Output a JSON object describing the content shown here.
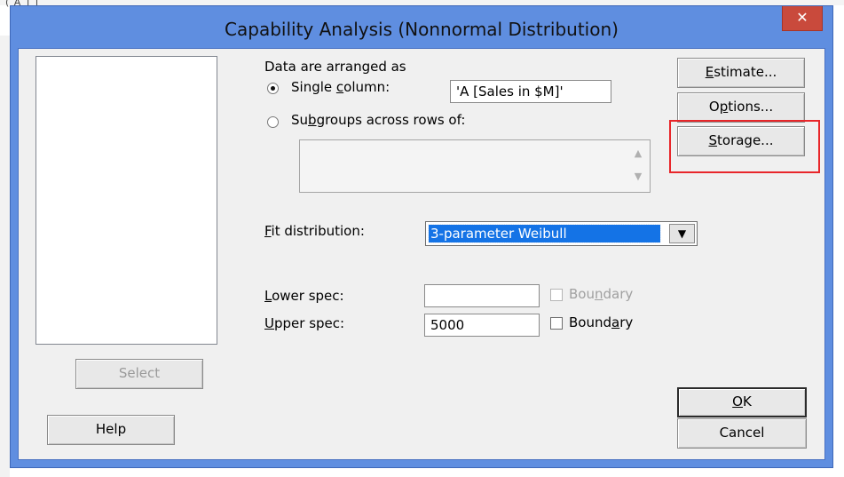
{
  "dialog": {
    "title": "Capability Analysis (Nonnormal Distribution)",
    "close_glyph": "✕"
  },
  "backdrop": {
    "fragment": "( A ] ]"
  },
  "variable_list": {
    "items": []
  },
  "data_arrangement": {
    "heading": "Data are arranged as",
    "single_column": {
      "label_pre": "Single ",
      "label_key": "c",
      "label_post": "olumn:",
      "value": "'A [Sales in $M]'",
      "selected": true
    },
    "subgroups": {
      "label_pre": "Su",
      "label_key": "b",
      "label_post": "groups across rows of:",
      "value": "",
      "selected": false
    }
  },
  "fit_distribution": {
    "label_key": "F",
    "label_post": "it distribution:",
    "selected": "3-parameter Weibull"
  },
  "lower_spec": {
    "label_key": "L",
    "label_post": "ower spec:",
    "value": "",
    "boundary_pre": "Bou",
    "boundary_key": "n",
    "boundary_post": "dary",
    "boundary_enabled": false
  },
  "upper_spec": {
    "label_key": "U",
    "label_post": "pper spec:",
    "value": "5000",
    "boundary_pre": "Bound",
    "boundary_key": "a",
    "boundary_post": "ry",
    "boundary_enabled": true
  },
  "buttons": {
    "estimate": {
      "key": "E",
      "post": "stimate..."
    },
    "options": {
      "pre": "O",
      "key": "p",
      "post": "tions..."
    },
    "storage": {
      "key": "S",
      "post": "torage..."
    },
    "select": "Select",
    "help": "Help",
    "ok": {
      "key": "O",
      "post": "K"
    },
    "cancel": "Cancel"
  },
  "colors": {
    "highlight": "#e8262a",
    "selection": "#1473e6"
  }
}
